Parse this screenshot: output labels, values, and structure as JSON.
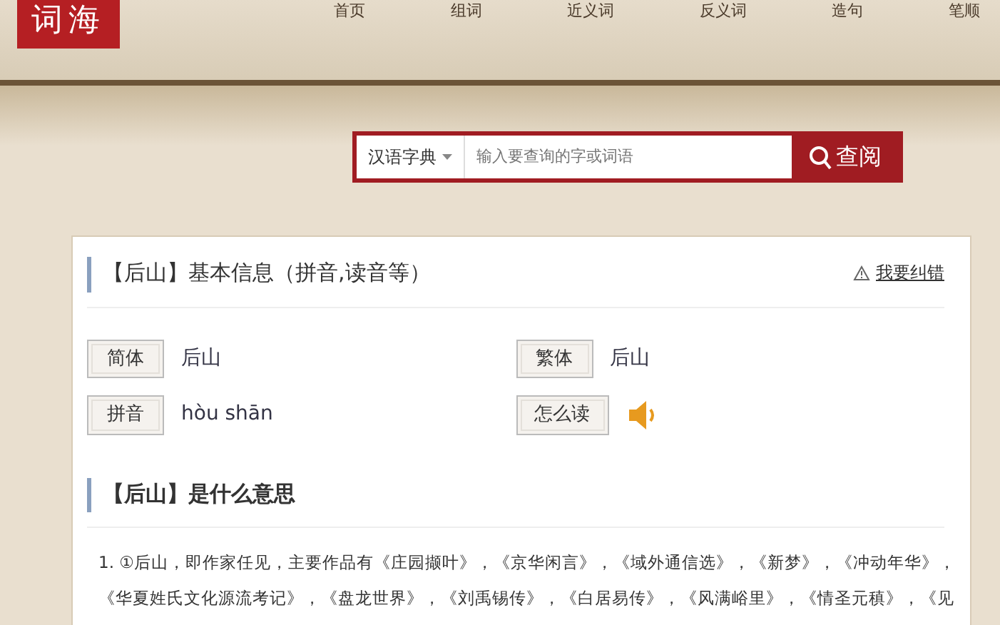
{
  "logo": "词海",
  "nav": [
    {
      "label": "首页"
    },
    {
      "label": "组词"
    },
    {
      "label": "近义词"
    },
    {
      "label": "反义词"
    },
    {
      "label": "造句"
    },
    {
      "label": "笔顺"
    }
  ],
  "search": {
    "dictionary": "汉语字典",
    "placeholder": "输入要查询的字或词语",
    "button": "查阅"
  },
  "basic_info": {
    "title": "【后山】基本信息（拼音,读音等）",
    "report": "我要纠错",
    "fields": [
      {
        "label": "简体",
        "value": "后山",
        "kind": "text"
      },
      {
        "label": "繁体",
        "value": "后山",
        "kind": "text"
      },
      {
        "label": "拼音",
        "value": "hòu shān",
        "kind": "text"
      },
      {
        "label": "怎么读",
        "kind": "audio"
      }
    ]
  },
  "meaning": {
    "title": "【后山】是什么意思",
    "lines": [
      "1. ①后山，即作家任见，主要作品有《庄园撷叶》，《京华闲言》，《域外通信选》，《新梦》，《冲动年华》，",
      "《华夏姓氏文化源流考记》，《盘龙世界》，《刘禹锡传》，《白居易传》，《风满峪里》，《情圣元稹》，《见"
    ]
  }
}
